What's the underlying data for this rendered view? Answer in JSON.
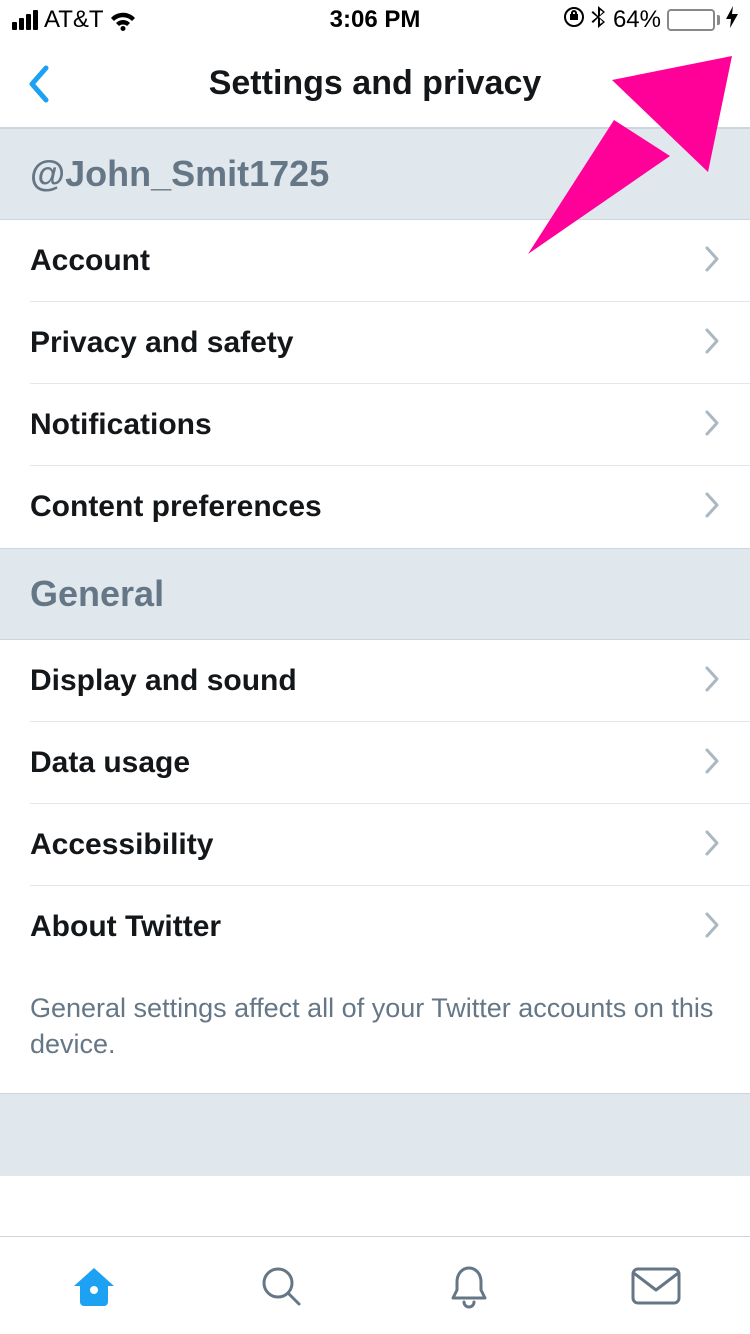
{
  "status_bar": {
    "carrier": "AT&T",
    "time": "3:06 PM",
    "battery_percent": "64%",
    "battery_fill_pct": 64
  },
  "header": {
    "title": "Settings and privacy"
  },
  "sections": {
    "user_handle": "@John_Smit1725",
    "account_items": [
      {
        "label": "Account"
      },
      {
        "label": "Privacy and safety"
      },
      {
        "label": "Notifications"
      },
      {
        "label": "Content preferences"
      }
    ],
    "general_title": "General",
    "general_items": [
      {
        "label": "Display and sound"
      },
      {
        "label": "Data usage"
      },
      {
        "label": "Accessibility"
      },
      {
        "label": "About Twitter"
      }
    ],
    "general_footer": "General settings affect all of your Twitter accounts on this device."
  },
  "colors": {
    "accent": "#1DA1F2",
    "overlay_arrow": "#FF0099"
  }
}
